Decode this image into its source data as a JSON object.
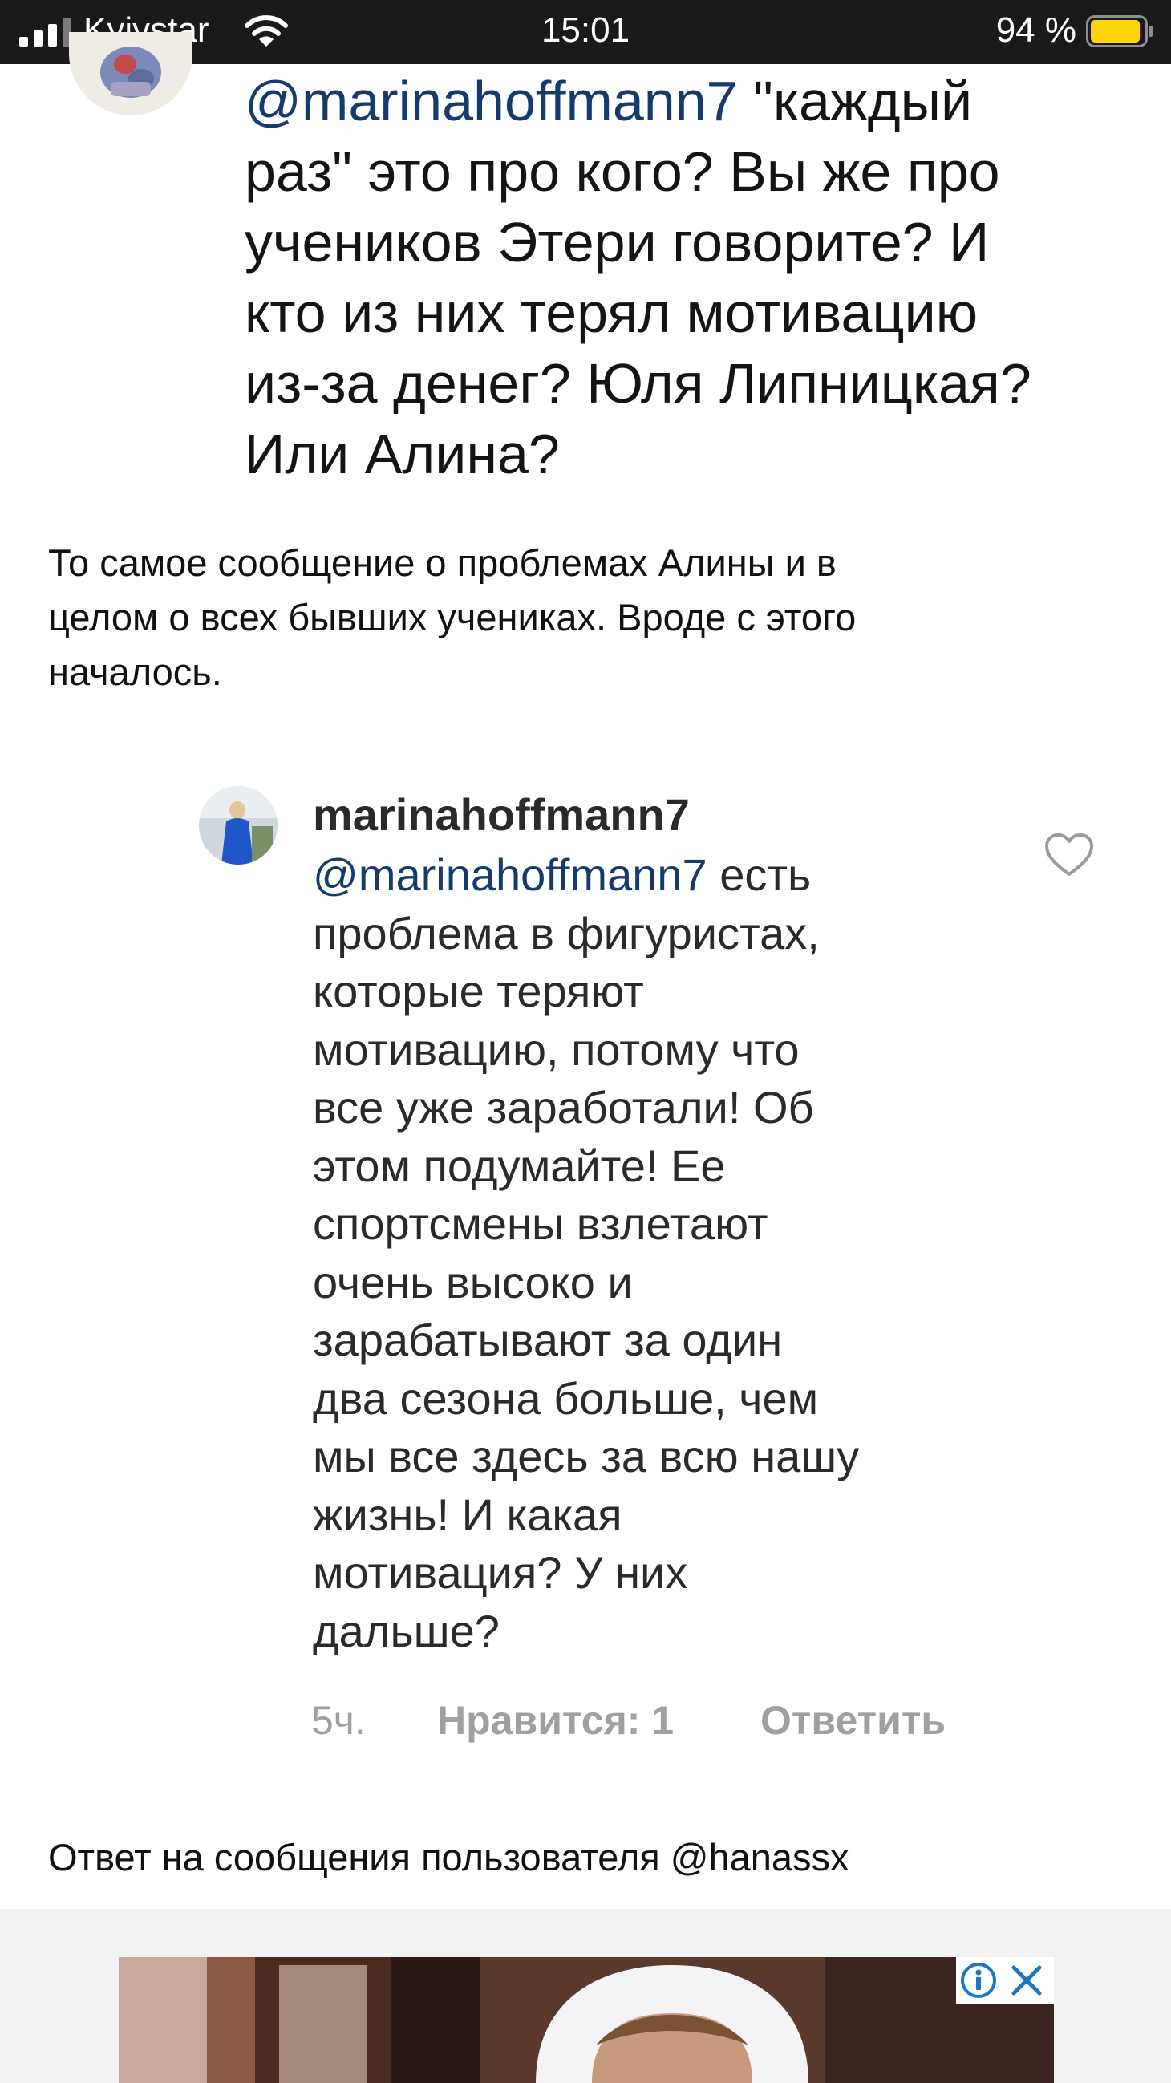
{
  "status_bar": {
    "carrier": "Kyivstar",
    "time": "15:01",
    "battery": "94 %",
    "battery_color": "#ffd60a",
    "icons": [
      "signal-bars-icon",
      "wifi-icon",
      "battery-icon"
    ]
  },
  "quoted_comment": {
    "mention": "@marinahoffmann7",
    "lines": [
      "\"каждый",
      "раз\" это про кого?  Вы же про",
      "учеников Этери говорите? И",
      "кто из них терял мотивацию",
      "из-за денег? Юля Липницкая?",
      "Или Алина?"
    ]
  },
  "caption_1": [
    "То самое сообщение о проблемах Алины и в",
    "целом о всех бывших учениках. Вроде с этого",
    "началось."
  ],
  "reply_comment": {
    "username": "marinahoffmann7",
    "mention": "@marinahoffmann7",
    "lines": [
      " есть",
      "проблема в фигуристах,",
      "которые теряют",
      "мотивацию, потому что",
      "все уже заработали! Об",
      "этом подумайте! Ее",
      "спортсмены взлетают",
      "очень высоко и",
      "зарабатывают за один",
      "два сезона больше, чем",
      "мы все здесь за всю нашу",
      "жизнь! И какая",
      "мотивация? У них",
      "дальше?"
    ],
    "time": "5ч.",
    "likes": "Нравится: 1",
    "reply_label": "Ответить",
    "like_icon": "heart-outline-icon"
  },
  "caption_2": "Ответ на сообщения пользователя @hanassx",
  "ad": {
    "info_icon": "info-icon",
    "close_icon": "close-icon",
    "accent_color": "#1a78c2"
  }
}
